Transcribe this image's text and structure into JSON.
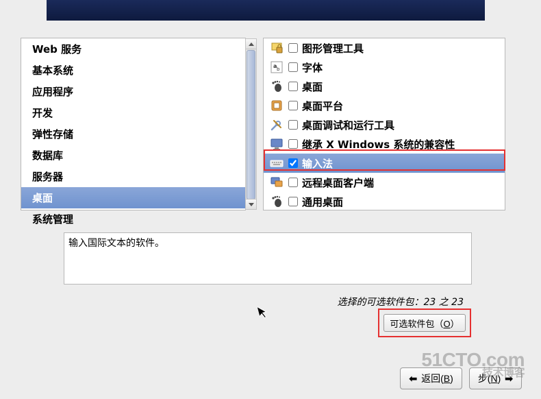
{
  "left_categories": [
    {
      "label": "Web 服务",
      "selected": false
    },
    {
      "label": "基本系统",
      "selected": false
    },
    {
      "label": "应用程序",
      "selected": false
    },
    {
      "label": "开发",
      "selected": false
    },
    {
      "label": "弹性存储",
      "selected": false
    },
    {
      "label": "数据库",
      "selected": false
    },
    {
      "label": "服务器",
      "selected": false
    },
    {
      "label": "桌面",
      "selected": true
    },
    {
      "label": "系统管理",
      "selected": false
    }
  ],
  "right_packages": [
    {
      "icon": "lock-icon",
      "checked": false,
      "label": "图形管理工具",
      "selected": false
    },
    {
      "icon": "font-icon",
      "checked": false,
      "label": "字体",
      "selected": false
    },
    {
      "icon": "gnome-foot-icon",
      "checked": false,
      "label": "桌面",
      "selected": false
    },
    {
      "icon": "platform-icon",
      "checked": false,
      "label": "桌面平台",
      "selected": false
    },
    {
      "icon": "tools-icon",
      "checked": false,
      "label": "桌面调试和运行工具",
      "selected": false
    },
    {
      "icon": "monitor-icon",
      "checked": false,
      "label": "继承 X Windows 系统的兼容性",
      "selected": false
    },
    {
      "icon": "keyboard-icon",
      "checked": true,
      "label": "输入法",
      "selected": true
    },
    {
      "icon": "remote-icon",
      "checked": false,
      "label": "远程桌面客户端",
      "selected": false
    },
    {
      "icon": "gnome-foot-icon",
      "checked": false,
      "label": "通用桌面",
      "selected": false
    }
  ],
  "description": "输入国际文本的软件。",
  "selection_info": "选择的可选软件包：23 之 23",
  "buttons": {
    "optional_packages": "可选软件包（",
    "optional_packages_key": "O",
    "optional_packages_suffix": "）",
    "back": "返回(",
    "back_key": "B",
    "back_suffix": ")",
    "next": "步(",
    "next_key": "N",
    "next_suffix": ")"
  },
  "watermark": {
    "main": "51CTO.com",
    "sub": "技术博客"
  }
}
